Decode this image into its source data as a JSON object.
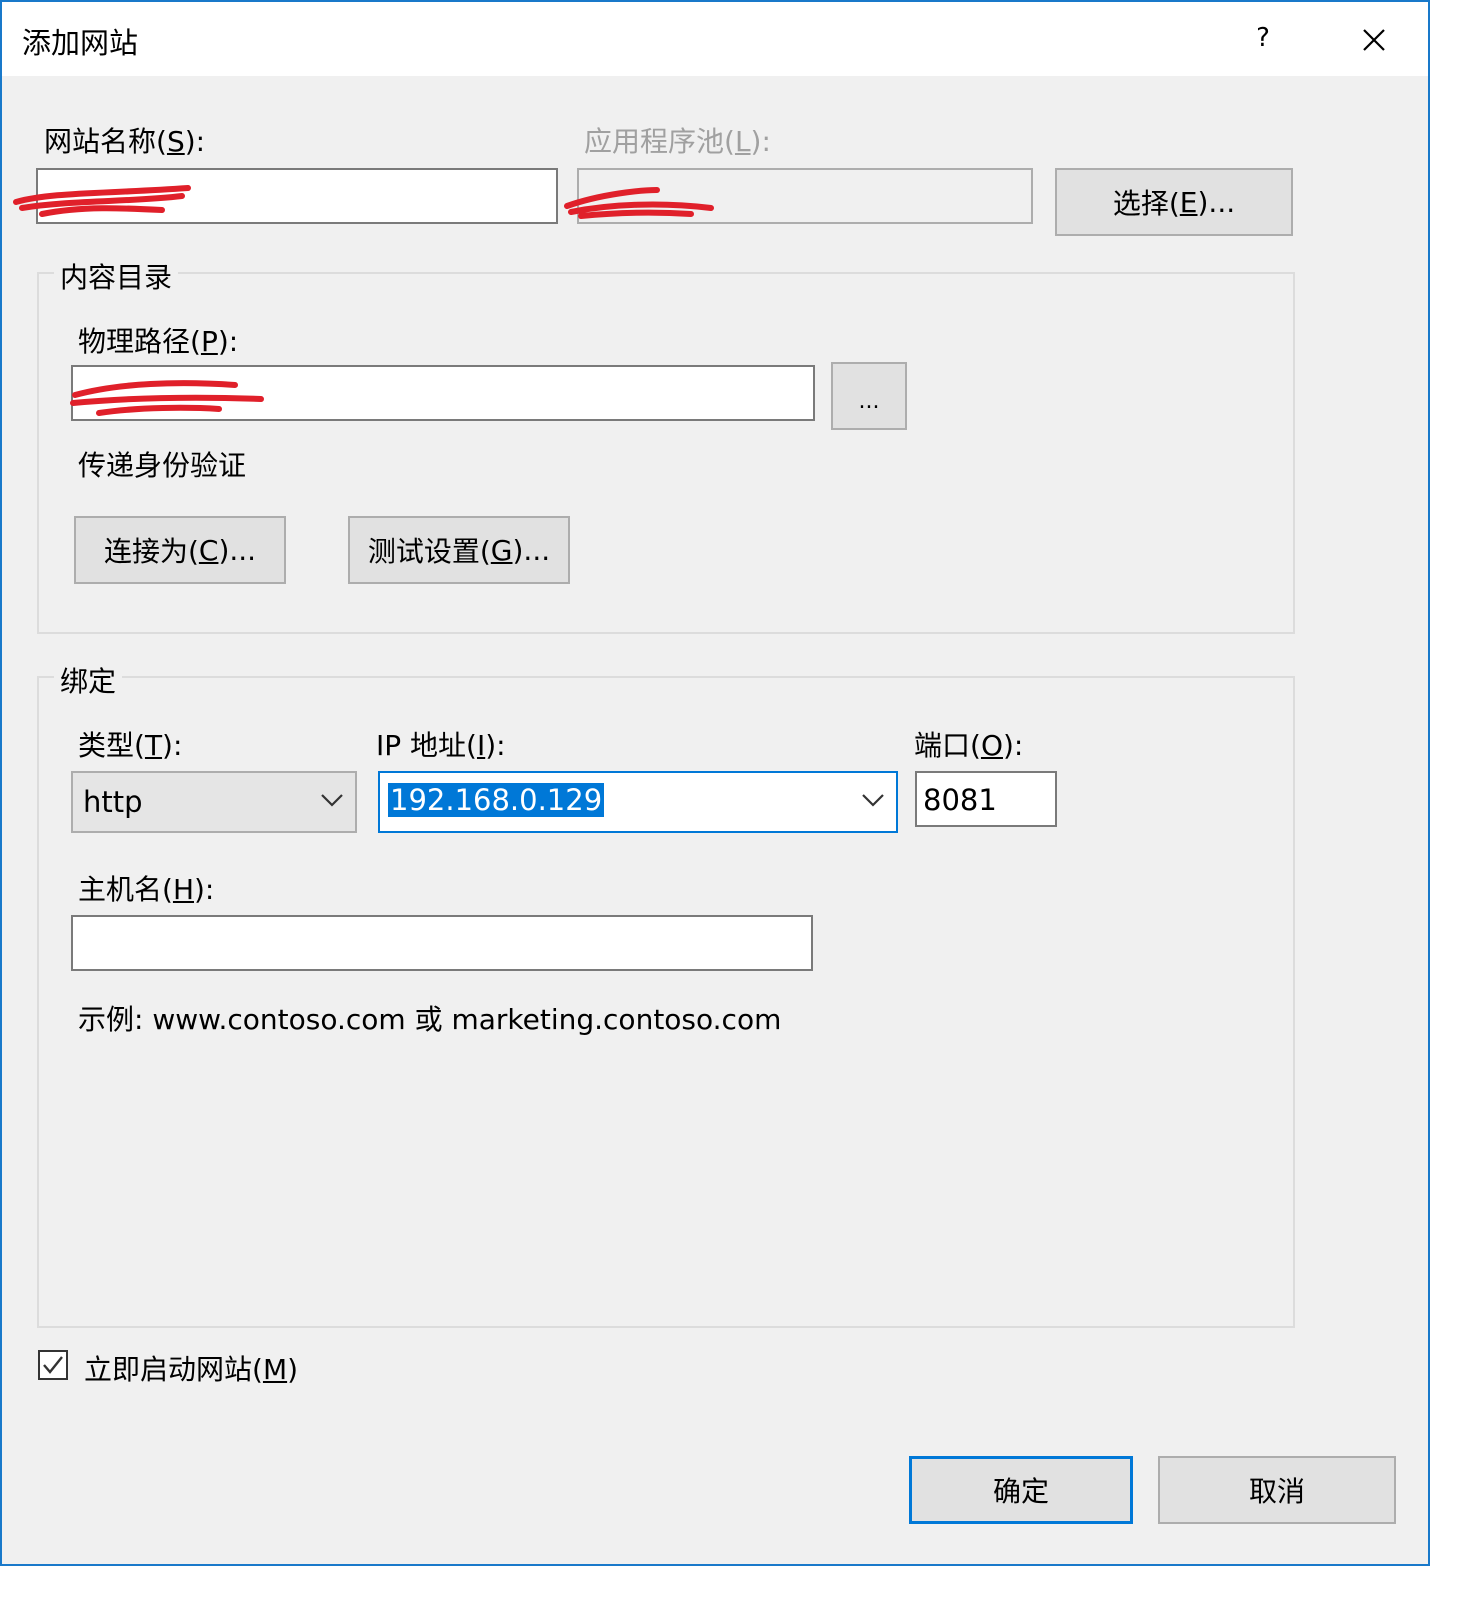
{
  "window": {
    "title": "添加网站",
    "help_label": "?",
    "close_label": "✕"
  },
  "site": {
    "name_label_pre": "网站名称(",
    "name_label_key": "S",
    "name_label_post": "):",
    "pool_label_pre": "应用程序池(",
    "pool_label_key": "L",
    "pool_label_post": "):",
    "select_pre": "选择(",
    "select_key": "E",
    "select_post": ")..."
  },
  "content": {
    "group_title": "内容目录",
    "path_label_pre": "物理路径(",
    "path_label_key": "P",
    "path_label_post": "):",
    "browse_label": "...",
    "passthrough_label": "传递身份验证",
    "connect_pre": "连接为(",
    "connect_key": "C",
    "connect_post": ")...",
    "test_pre": "测试设置(",
    "test_key": "G",
    "test_post": ")..."
  },
  "binding": {
    "group_title": "绑定",
    "type_label_pre": "类型(",
    "type_label_key": "T",
    "type_label_post": "):",
    "type_value": "http",
    "ip_label_pre": "IP 地址(",
    "ip_label_key": "I",
    "ip_label_post": "):",
    "ip_value": "192.168.0.129",
    "port_label_pre": "端口(",
    "port_label_key": "O",
    "port_label_post": "):",
    "port_value": "8081",
    "host_label_pre": "主机名(",
    "host_label_key": "H",
    "host_label_post": "):",
    "host_value": "",
    "example_text": "示例: www.contoso.com 或 marketing.contoso.com"
  },
  "start": {
    "label_pre": "立即启动网站(",
    "label_key": "M",
    "label_post": ")",
    "checked": true
  },
  "footer": {
    "ok_label": "确定",
    "cancel_label": "取消"
  },
  "colors": {
    "accent": "#0078d7",
    "redaction": "#e0202a",
    "window_border": "#1979ca"
  }
}
